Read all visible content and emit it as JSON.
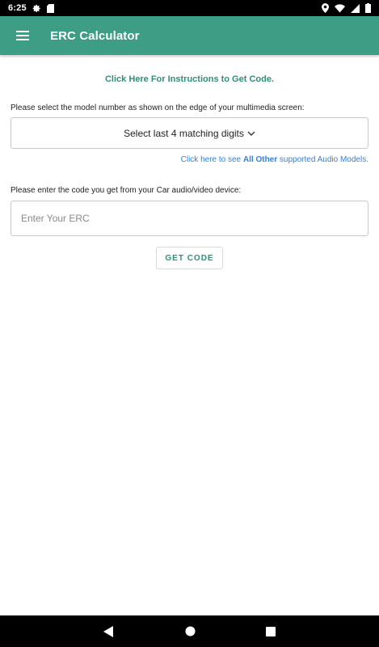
{
  "status_bar": {
    "time": "6:25",
    "icons_left": [
      "gear-icon",
      "sd-card-icon"
    ],
    "icons_right": [
      "location-icon",
      "wifi-icon",
      "signal-icon",
      "battery-icon"
    ]
  },
  "app_bar": {
    "title": "ERC Calculator",
    "menu_icon": "hamburger-menu-icon",
    "color": "#3d9d85"
  },
  "main": {
    "instructions_link": "Click Here For Instructions to Get Code.",
    "model_prompt": "Please select the model number as shown on the edge of your multimedia screen:",
    "model_select": {
      "selected_value": "Select last 4 matching digits",
      "icon": "chevron-down-icon"
    },
    "other_models": {
      "prefix": "Click here to see ",
      "emphasis": "All Other",
      "suffix": " supported Audio Models."
    },
    "code_prompt": "Please enter the code you get from your Car audio/video device:",
    "erc_input": {
      "value": "",
      "placeholder": "Enter Your ERC"
    },
    "get_code_label": "GET CODE"
  },
  "nav_bar": {
    "back_icon": "back-triangle-icon",
    "home_icon": "home-circle-icon",
    "recents_icon": "recents-square-icon"
  },
  "colors": {
    "accent": "#3d9d85",
    "link_green": "#2e8f77",
    "link_blue": "#2f80ed"
  }
}
